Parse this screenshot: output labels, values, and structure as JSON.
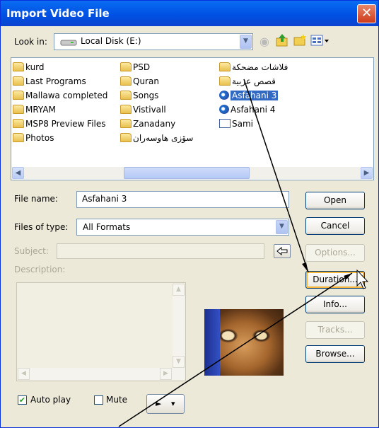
{
  "window": {
    "title": "Import Video File",
    "close_symbol": "✕"
  },
  "look_in": {
    "label": "Look in:",
    "drive_icon": "drive-icon",
    "value": "Local Disk (E:)",
    "toolbar_icons": [
      "back-icon",
      "up-folder-icon",
      "new-folder-icon",
      "views-menu-icon"
    ]
  },
  "files": {
    "col1": [
      "kurd",
      "Last Programs",
      "Mallawa completed",
      "MRYAM",
      "MSP8 Preview Files",
      "Photos"
    ],
    "col2": [
      "PSD",
      "Quran",
      "Songs",
      "Vistivall",
      "Zanadany",
      "سۆزی هاوسەران"
    ],
    "col3": [
      {
        "name": "فلاشات مضحكة",
        "icon": "folder-icon"
      },
      {
        "name": "قصص عربية",
        "icon": "folder-icon"
      },
      {
        "name": "Asfahani 3",
        "icon": "video-file-icon",
        "selected": true
      },
      {
        "name": "Asfahani 4",
        "icon": "video-file-icon"
      },
      {
        "name": "Sami",
        "icon": "document-icon"
      }
    ]
  },
  "file_name": {
    "label": "File name:",
    "value": "Asfahani 3"
  },
  "file_type": {
    "label": "Files of type:",
    "value": "All Formats"
  },
  "subject_label": "Subject:",
  "description_label": "Description:",
  "buttons": {
    "open": "Open",
    "cancel": "Cancel",
    "options": "Options...",
    "duration": "Duration...",
    "info": "Info...",
    "tracks": "Tracks...",
    "browse": "Browse..."
  },
  "checkboxes": {
    "auto_play": {
      "label": "Auto play",
      "checked": true
    },
    "mute": {
      "label": "Mute",
      "checked": false
    }
  },
  "play_menu": {
    "play_symbol": "►",
    "dropdown_symbol": "▾"
  },
  "colors": {
    "titlebar": "#0a5ae8",
    "selection": "#316ac5",
    "window_bg": "#ece9d8"
  }
}
